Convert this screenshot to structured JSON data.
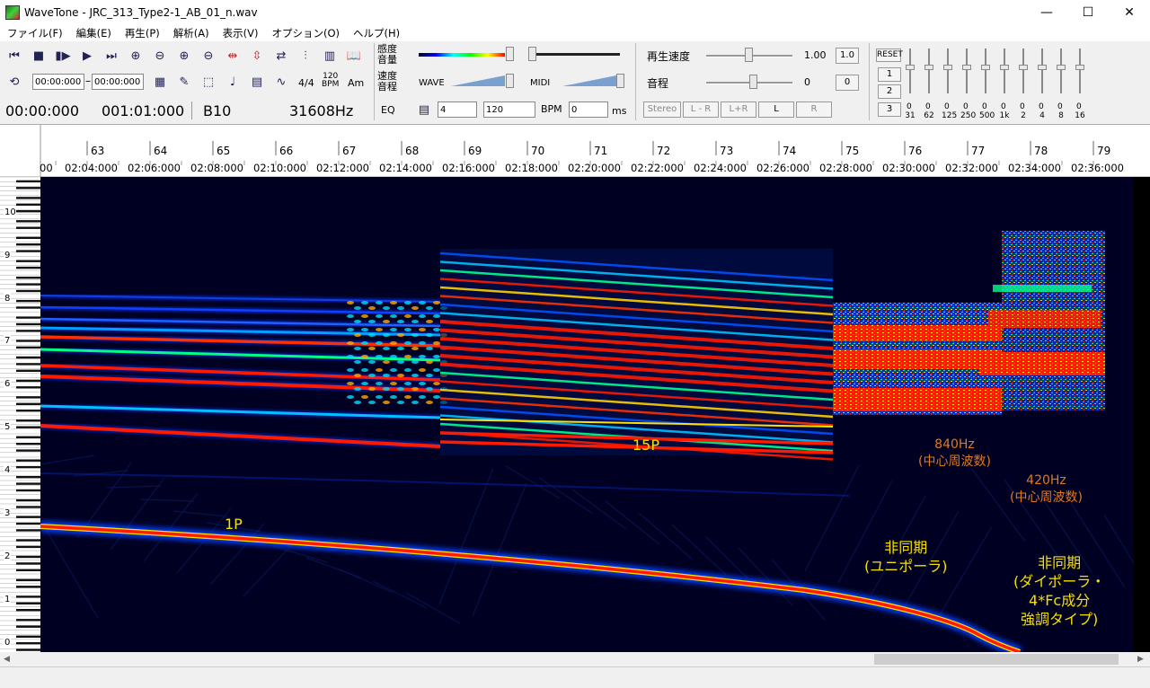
{
  "window": {
    "title": "WaveTone - JRC_313_Type2-1_AB_01_n.wav",
    "minimize": "—",
    "maximize": "☐",
    "close": "✕"
  },
  "menu": [
    "ファイル(F)",
    "編集(E)",
    "再生(P)",
    "解析(A)",
    "表示(V)",
    "オプション(O)",
    "ヘルプ(H)"
  ],
  "toolbar": {
    "time_from": "00:00:000",
    "time_to": "00:00:000",
    "time_sep": "–",
    "beat_label": "4/4",
    "bpm_icon_top": "120",
    "bpm_icon_bottom": "BPM",
    "am_label": "Am",
    "sensitivity_label": [
      "感度",
      "音量"
    ],
    "speed_pitch_label": [
      "速度",
      "音程"
    ],
    "eq_label": "EQ",
    "wave_label": "WAVE",
    "midi_label": "MIDI",
    "beat_value": "4",
    "bpm_value": "120",
    "bpm_label": "BPM",
    "ms_value": "0",
    "ms_label": "ms",
    "playback_speed_label": "再生速度",
    "playback_speed_value": "1.00",
    "playback_speed_btn": "1.0",
    "pitch_label": "音程",
    "pitch_value": "0",
    "pitch_btn": "0",
    "stereo_label": "Stereo",
    "channel_buttons": [
      "L - R",
      "L+R",
      "L",
      "R"
    ],
    "reset_label": "RESET",
    "preset_buttons": [
      "1",
      "2",
      "3"
    ],
    "eq_bands": [
      {
        "value": "0",
        "freq": "31"
      },
      {
        "value": "0",
        "freq": "62"
      },
      {
        "value": "0",
        "freq": "125"
      },
      {
        "value": "0",
        "freq": "250"
      },
      {
        "value": "0",
        "freq": "500"
      },
      {
        "value": "0",
        "freq": "1k"
      },
      {
        "value": "0",
        "freq": "2"
      },
      {
        "value": "0",
        "freq": "4"
      },
      {
        "value": "0",
        "freq": "8"
      },
      {
        "value": "0",
        "freq": "16"
      }
    ]
  },
  "status": {
    "time": "00:00:000",
    "measure": "001:01:000",
    "note": "B10",
    "frequency": "31608Hz"
  },
  "ruler": {
    "measures": [
      "63",
      "64",
      "65",
      "66",
      "67",
      "68",
      "69",
      "70",
      "71",
      "72",
      "73",
      "74",
      "75",
      "76",
      "77",
      "78",
      "79"
    ],
    "times": [
      "00",
      "02:04:000",
      "02:06:000",
      "02:08:000",
      "02:10:000",
      "02:12:000",
      "02:14:000",
      "02:16:000",
      "02:18:000",
      "02:20:000",
      "02:22:000",
      "02:24:000",
      "02:26:000",
      "02:28:000",
      "02:30:000",
      "02:32:000",
      "02:34:000",
      "02:36:000"
    ]
  },
  "y_axis_labels": [
    "10",
    "9",
    "8",
    "7",
    "6",
    "5",
    "4",
    "3",
    "2",
    "1",
    "0"
  ],
  "annotations": {
    "p1": "1P",
    "p15": "15P",
    "hz840": [
      "840Hz",
      "(中心周波数)"
    ],
    "hz420": [
      "420Hz",
      "(中心周波数)"
    ],
    "async_uni": [
      "非同期",
      "(ユニポーラ)"
    ],
    "async_di": [
      "非同期",
      "(ダイポーラ・",
      "4*Fc成分",
      "強調タイプ)"
    ]
  },
  "colors": {
    "spectro_bg": "#000022",
    "annotation_yellow": "#f5e000",
    "annotation_orange": "#e07820",
    "band_red": "#ff1a00"
  }
}
